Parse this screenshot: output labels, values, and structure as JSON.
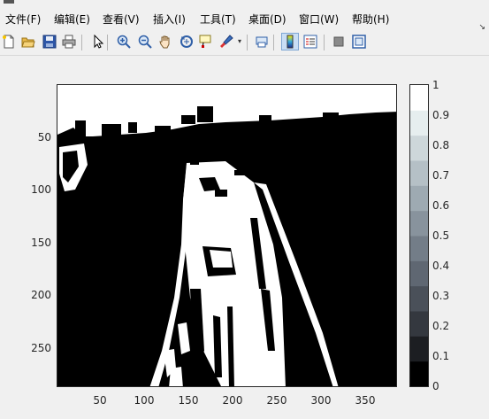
{
  "window": {
    "partial_title": ""
  },
  "menu": [
    {
      "label": "文件(F)",
      "name": "menu-file"
    },
    {
      "label": "编辑(E)",
      "name": "menu-edit"
    },
    {
      "label": "查看(V)",
      "name": "menu-view"
    },
    {
      "label": "插入(I)",
      "name": "menu-insert"
    },
    {
      "label": "工具(T)",
      "name": "menu-tools"
    },
    {
      "label": "桌面(D)",
      "name": "menu-desktop"
    },
    {
      "label": "窗口(W)",
      "name": "menu-window"
    },
    {
      "label": "帮助(H)",
      "name": "menu-help"
    }
  ],
  "menu_overflow_icon": "chevron-down-icon",
  "toolbar": {
    "buttons": [
      {
        "name": "new-figure-button",
        "icon": "new-file-icon"
      },
      {
        "name": "open-file-button",
        "icon": "folder-open-icon"
      },
      {
        "name": "save-button",
        "icon": "save-icon"
      },
      {
        "name": "print-button",
        "icon": "printer-icon"
      },
      {
        "name": "edit-plot-button",
        "icon": "arrow-cursor-icon"
      },
      {
        "name": "zoom-in-button",
        "icon": "zoom-in-icon"
      },
      {
        "name": "zoom-out-button",
        "icon": "zoom-out-icon"
      },
      {
        "name": "pan-button",
        "icon": "hand-icon"
      },
      {
        "name": "rotate-3d-button",
        "icon": "rotate-icon"
      },
      {
        "name": "data-cursor-button",
        "icon": "data-tip-icon"
      },
      {
        "name": "brush-button",
        "icon": "brush-icon"
      },
      {
        "name": "link-plot-button",
        "icon": "link-icon"
      },
      {
        "name": "colorbar-toggle-button",
        "icon": "colorbar-icon",
        "active": true
      },
      {
        "name": "legend-toggle-button",
        "icon": "legend-icon"
      },
      {
        "name": "hide-plot-tools-button",
        "icon": "square-icon"
      },
      {
        "name": "show-plot-tools-button",
        "icon": "window-icon"
      }
    ]
  },
  "plot": {
    "y_ticks": [
      "50",
      "100",
      "150",
      "200",
      "250"
    ],
    "x_ticks": [
      "50",
      "100",
      "150",
      "200",
      "250",
      "300",
      "350"
    ],
    "colorbar_ticks": [
      "1",
      "0.9",
      "0.8",
      "0.7",
      "0.6",
      "0.5",
      "0.4",
      "0.3",
      "0.2",
      "0.1",
      "0"
    ],
    "colorbar_colors": [
      "#000000",
      "#1c1e22",
      "#34383f",
      "#4a5059",
      "#5f6772",
      "#737d88",
      "#88939d",
      "#9eaab2",
      "#b5c0c6",
      "#cdd7da",
      "#e6eeef",
      "#ffffff"
    ]
  },
  "chart_data": {
    "type": "heatmap",
    "title": "",
    "xlabel": "",
    "ylabel": "",
    "x_ticks": [
      50,
      100,
      150,
      200,
      250,
      300,
      350
    ],
    "y_ticks": [
      50,
      100,
      150,
      200,
      250
    ],
    "colorbar": {
      "ticks": [
        0,
        0.1,
        0.2,
        0.3,
        0.4,
        0.5,
        0.6,
        0.7,
        0.8,
        0.9,
        1
      ],
      "range": [
        0,
        1
      ]
    }
  }
}
